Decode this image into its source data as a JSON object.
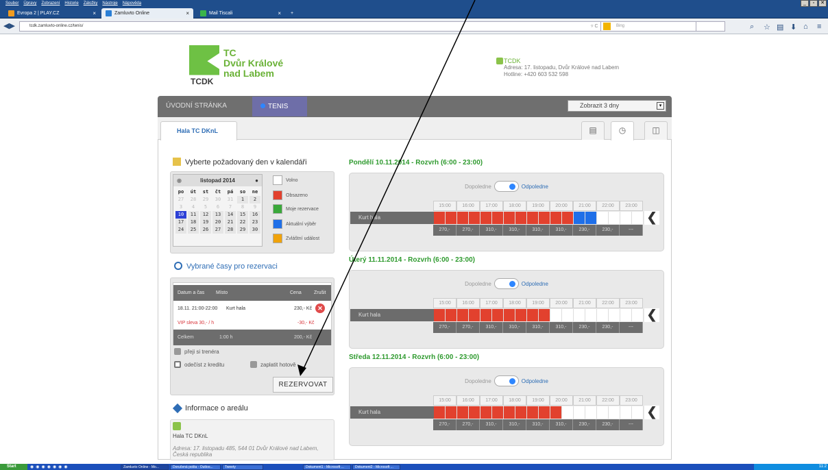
{
  "browser": {
    "menu": [
      "Soubor",
      "Úpravy",
      "Zobrazení",
      "Historie",
      "Záložky",
      "Nástroje",
      "Nápověda"
    ],
    "tabs": [
      {
        "label": "Evropa 2 | PLAY.CZ"
      },
      {
        "label": "Zamluvto Online"
      },
      {
        "label": "Mail Tiscali"
      }
    ],
    "url": "tcdk.zamluvto-online.cz/tenis/",
    "search_placeholder": "Bing",
    "newtab": "+"
  },
  "header": {
    "logo_line1": "TC",
    "logo_line2": "Dvůr Králové",
    "logo_line3": "nad Labem",
    "logo_abbr": "TCDK",
    "contact_title": "TCDK",
    "contact_address": "Adresa: 17. listopadu, Dvůr Králové nad Labem",
    "contact_hotline": "Hotline: +420 603 532 598"
  },
  "nav": {
    "home": "ÚVODNÍ STRÁNKA",
    "tenis": "TENIS",
    "select_view": "Zobrazit 3 dny"
  },
  "hall_tab": "Hala TC DKnL",
  "calendar": {
    "title": "Vyberte požadovaný den v kalendáři",
    "month": "listopad 2014",
    "weekdays": [
      "po",
      "út",
      "st",
      "čt",
      "pá",
      "so",
      "ne"
    ],
    "weeks": [
      [
        "27",
        "28",
        "29",
        "30",
        "31",
        "1",
        "2"
      ],
      [
        "3",
        "4",
        "5",
        "6",
        "7",
        "8",
        "9"
      ],
      [
        "10",
        "11",
        "12",
        "13",
        "14",
        "15",
        "16"
      ],
      [
        "17",
        "18",
        "19",
        "20",
        "21",
        "22",
        "23"
      ],
      [
        "24",
        "25",
        "26",
        "27",
        "28",
        "29",
        "30"
      ]
    ],
    "legend": [
      {
        "label": "Volno",
        "color": "#ffffff"
      },
      {
        "label": "Obsazeno",
        "color": "#e2412e"
      },
      {
        "label": "Moje rezervace",
        "color": "#3aa83a"
      },
      {
        "label": "Aktuální výběr",
        "color": "#1f6fe8"
      },
      {
        "label": "Zvláštní událost",
        "color": "#f0a20a"
      }
    ]
  },
  "reservation": {
    "title": "Vybrané časy pro rezervaci",
    "headers": {
      "date": "Datum a čas",
      "place": "Místo",
      "price": "Cena",
      "cancel": "Zrušit"
    },
    "item": {
      "date": "18.11. 21:00-22:00",
      "place": "Kurt hala",
      "price": "230,- Kč"
    },
    "vip": {
      "label": "VIP sleva 30,- / h",
      "price": "-30,- Kč"
    },
    "total": {
      "label": "Celkem",
      "hours": "1:00 h",
      "price": "200,- Kč"
    },
    "trainer": "přeji si trenéra",
    "credit": "odečíst z kreditu",
    "cash": "zaplatit hotově",
    "submit": "REZERVOVAT"
  },
  "info": {
    "title": "Informace o areálu",
    "name": "Hala TC DKnL",
    "address": "Adresa: 17. listopadu 485, 544 01 Dvůr Králové nad Labem, Česká republika"
  },
  "days": [
    {
      "title": "Pondělí 10.11.2014 - Rozvrh (6:00 - 23:00)",
      "slots": [
        "r",
        "r",
        "r",
        "r",
        "r",
        "r",
        "r",
        "r",
        "r",
        "r",
        "r",
        "r",
        "b",
        "b",
        "w",
        "w",
        "w",
        "w"
      ]
    },
    {
      "title": "Úterý 11.11.2014 - Rozvrh (6:00 - 23:00)",
      "slots": [
        "r",
        "r",
        "r",
        "r",
        "r",
        "r",
        "r",
        "r",
        "r",
        "r",
        "w",
        "w",
        "w",
        "w",
        "w",
        "w",
        "w",
        "w"
      ]
    },
    {
      "title": "Středa 12.11.2014 - Rozvrh (6:00 - 23:00)",
      "slots": [
        "r",
        "r",
        "r",
        "r",
        "r",
        "r",
        "r",
        "r",
        "r",
        "r",
        "r",
        "w",
        "w",
        "w",
        "w",
        "w",
        "w",
        "w"
      ]
    }
  ],
  "schedule": {
    "toggle_left": "Dopoledne",
    "toggle_right": "Odpoledne",
    "hours": [
      "15:00",
      "16:00",
      "17:00",
      "18:00",
      "19:00",
      "20:00",
      "21:00",
      "22:00",
      "23:00"
    ],
    "court": "Kurt hala",
    "prices": [
      "270,-",
      "270,-",
      "310,-",
      "310,-",
      "310,-",
      "310,-",
      "230,-",
      "230,-",
      "---"
    ]
  },
  "taskbar": {
    "start": "Start",
    "items": [
      "Zamluvto Online - Mo...",
      "Doručená pošta - Outloo...",
      "Tweety",
      "Dokument1 - Microsoft ...",
      "Dokument2 - Microsoft ..."
    ],
    "clock": "11:2"
  }
}
